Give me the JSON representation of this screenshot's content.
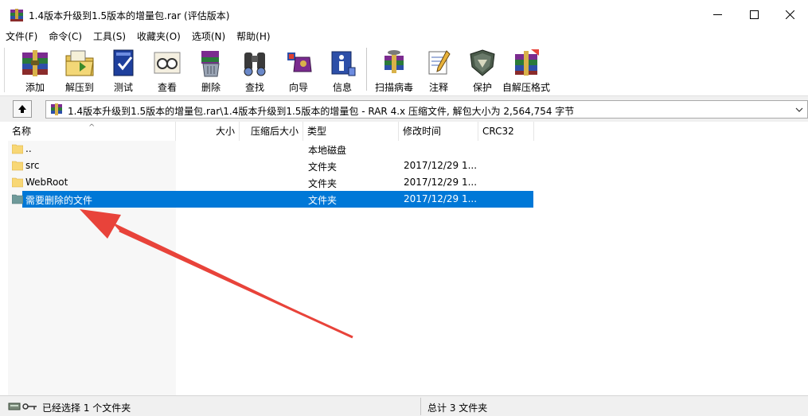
{
  "window": {
    "title": "1.4版本升级到1.5版本的增量包.rar (评估版本)"
  },
  "menu": [
    "文件(F)",
    "命令(C)",
    "工具(S)",
    "收藏夹(O)",
    "选项(N)",
    "帮助(H)"
  ],
  "toolbar": {
    "add": "添加",
    "extract": "解压到",
    "test": "测试",
    "view": "查看",
    "delete": "删除",
    "find": "查找",
    "wizard": "向导",
    "info": "信息",
    "virus_scan": "扫描病毒",
    "comment": "注释",
    "protect": "保护",
    "sfx": "自解压格式"
  },
  "address": {
    "path": "1.4版本升级到1.5版本的增量包.rar\\1.4版本升级到1.5版本的增量包 - RAR 4.x 压缩文件, 解包大小为 2,564,754 字节"
  },
  "columns": {
    "name": "名称",
    "size": "大小",
    "packed": "压缩后大小",
    "type": "类型",
    "modified": "修改时间",
    "crc": "CRC32"
  },
  "rows": [
    {
      "name": "..",
      "type": "本地磁盘",
      "modified": ""
    },
    {
      "name": "src",
      "type": "文件夹",
      "modified": "2017/12/29 1..."
    },
    {
      "name": "WebRoot",
      "type": "文件夹",
      "modified": "2017/12/29 1..."
    },
    {
      "name": "需要删除的文件",
      "type": "文件夹",
      "modified": "2017/12/29 1..."
    }
  ],
  "status": {
    "selected": "已经选择 1 个文件夹",
    "total": "总计 3 文件夹"
  },
  "colors": {
    "selection": "#0078d7",
    "annotation_arrow": "#e8433a",
    "folder": "#f8d775"
  }
}
